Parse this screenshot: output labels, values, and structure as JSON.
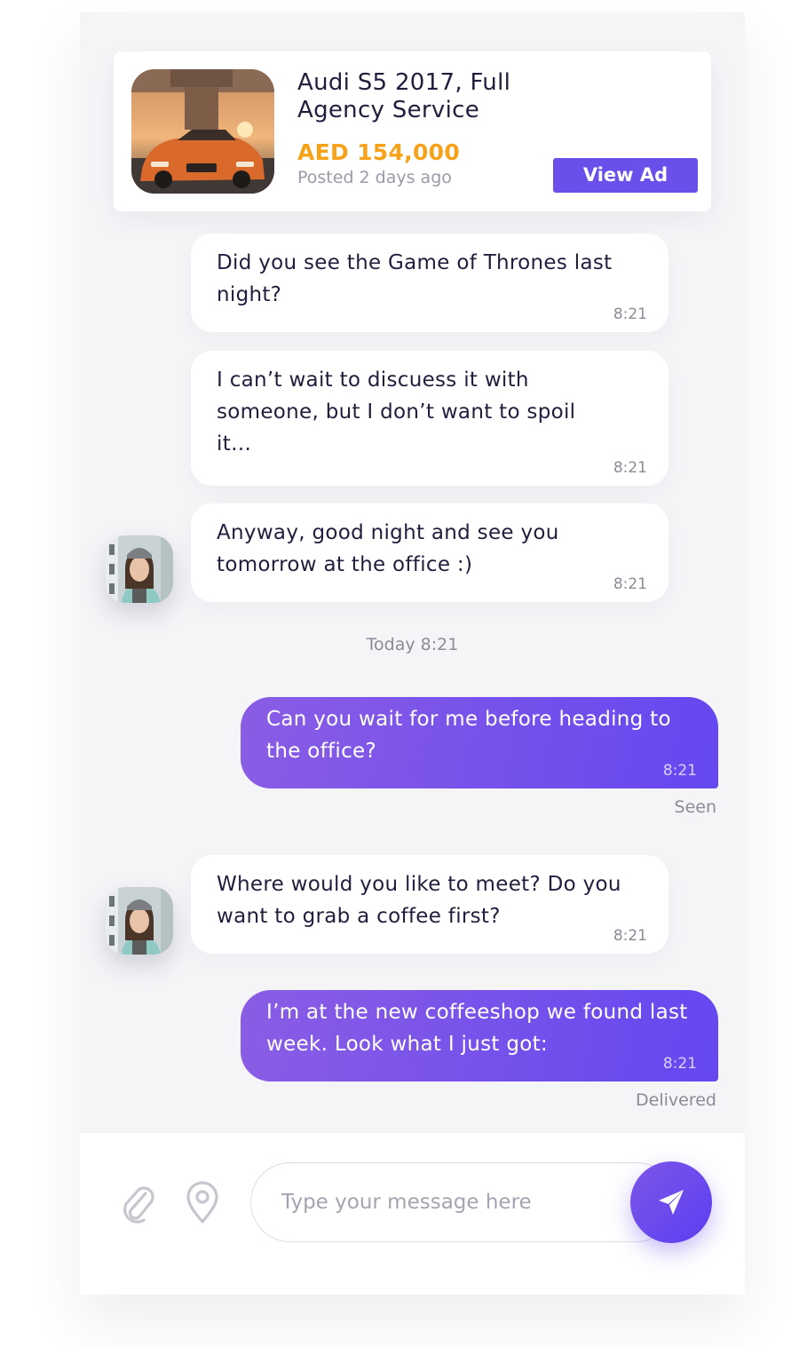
{
  "ad": {
    "title": "Audi S5 2017, Full Agency Service",
    "price": "AED 154,000",
    "posted": "Posted 2 days ago",
    "view_button": "View Ad"
  },
  "messages": [
    {
      "direction": "incoming",
      "text": "Did you see the Game of Thrones last night?",
      "time": "8:21"
    },
    {
      "direction": "incoming",
      "text": "I can’t wait to discuess it with someone, but I don’t want to spoil it…",
      "time": "8:21"
    },
    {
      "direction": "incoming",
      "text": "Anyway, good night and see you tomorrow at the office :)",
      "time": "8:21"
    },
    {
      "direction": "outgoing",
      "text": "Can you wait for me before heading to the office?",
      "time": "8:21",
      "status": "Seen"
    },
    {
      "direction": "incoming",
      "text": "Where would you like to meet? Do you want to grab a coffee first?",
      "time": "8:21"
    },
    {
      "direction": "outgoing",
      "text": "I’m at the new coffeeshop we found last week. Look what I just got:",
      "time": "8:21",
      "status": "Delivered"
    }
  ],
  "day_separator": "Today 8:21",
  "composer": {
    "placeholder": "Type your message here",
    "attach_icon": "paperclip-icon",
    "location_icon": "map-pin-icon",
    "send_icon": "paper-plane-icon"
  },
  "colors": {
    "accent": "#6b4fea",
    "price": "#f7a21b",
    "panel_bg": "#f5f5f8",
    "text": "#1f1f3d",
    "muted": "#8b8b98"
  }
}
